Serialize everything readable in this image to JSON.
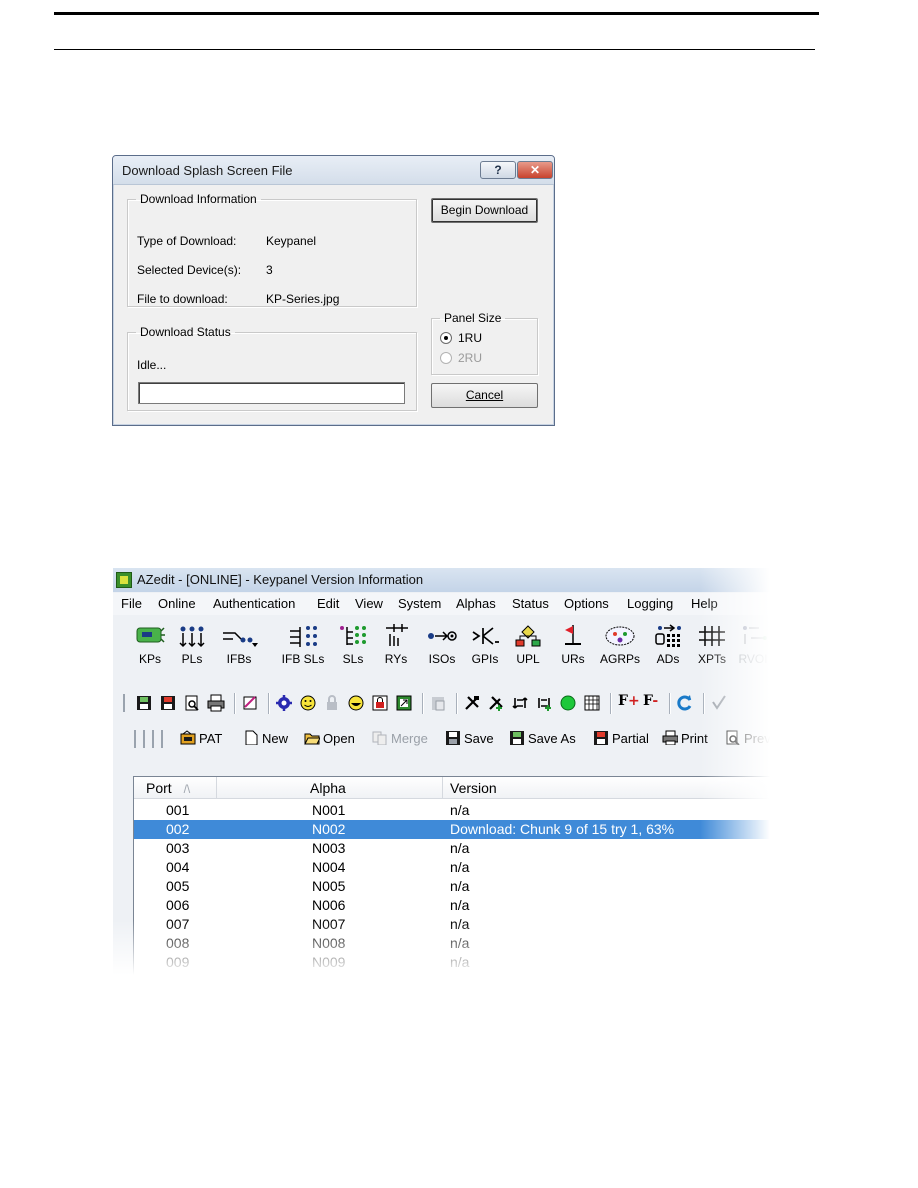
{
  "dialog": {
    "title": "Download Splash Screen File",
    "help_btn": "?",
    "close_btn": "✕",
    "download_info_legend": "Download Information",
    "rows": [
      {
        "label": "Type of Download:",
        "value": "Keypanel"
      },
      {
        "label": "Selected Device(s):",
        "value": "3"
      },
      {
        "label": "File to download:",
        "value": "KP-Series.jpg"
      }
    ],
    "status_legend": "Download Status",
    "status_text": "Idle...",
    "begin_btn": "Begin Download",
    "panel_size_legend": "Panel Size",
    "panel_sizes": [
      "1RU",
      "2RU"
    ],
    "panel_size_selected": "1RU",
    "cancel_btn": "Cancel"
  },
  "azedit": {
    "title": "AZedit - [ONLINE] - Keypanel Version Information",
    "menu": [
      "File",
      "Online",
      "Authentication",
      "Edit",
      "View",
      "System",
      "Alphas",
      "Status",
      "Options",
      "Logging",
      "Help"
    ],
    "big_toolbar": [
      {
        "label": "KPs",
        "icon": "keypanel-icon"
      },
      {
        "label": "PLs",
        "icon": "party-line-icon"
      },
      {
        "label": "IFBs",
        "icon": "ifb-icon"
      },
      {
        "label": "IFB SLs",
        "icon": "ifb-sl-icon"
      },
      {
        "label": "SLs",
        "icon": "special-list-icon"
      },
      {
        "label": "RYs",
        "icon": "relay-icon"
      },
      {
        "label": "ISOs",
        "icon": "iso-icon"
      },
      {
        "label": "GPIs",
        "icon": "gpi-icon"
      },
      {
        "label": "UPL",
        "icon": "upl-icon"
      },
      {
        "label": "URs",
        "icon": "ur-flag-icon"
      },
      {
        "label": "AGRPs",
        "icon": "agrp-icon"
      },
      {
        "label": "ADs",
        "icon": "ad-icon"
      },
      {
        "label": "XPTs",
        "icon": "crosspoint-icon"
      },
      {
        "label": "RVOI",
        "icon": "rvoi-icon"
      }
    ],
    "file_toolbar": [
      {
        "label": "PAT",
        "icon": "pat-icon"
      },
      {
        "label": "New",
        "icon": "new-file-icon"
      },
      {
        "label": "Open",
        "icon": "open-folder-icon"
      },
      {
        "label": "Merge",
        "icon": "merge-icon",
        "disabled": true
      },
      {
        "label": "Save",
        "icon": "save-icon"
      },
      {
        "label": "Save As",
        "icon": "save-as-icon"
      },
      {
        "label": "Partial",
        "icon": "partial-save-icon"
      },
      {
        "label": "Print",
        "icon": "print-icon"
      },
      {
        "label": "Prev",
        "icon": "print-preview-icon"
      }
    ],
    "list": {
      "headers": {
        "port": "Port",
        "alpha": "Alpha",
        "version": "Version"
      },
      "rows": [
        {
          "port": "001",
          "alpha": "N001",
          "version": "n/a"
        },
        {
          "port": "002",
          "alpha": "N002",
          "version": "Download: Chunk 9 of 15 try 1,  63%",
          "selected": true
        },
        {
          "port": "003",
          "alpha": "N003",
          "version": "n/a"
        },
        {
          "port": "004",
          "alpha": "N004",
          "version": "n/a"
        },
        {
          "port": "005",
          "alpha": "N005",
          "version": "n/a"
        },
        {
          "port": "006",
          "alpha": "N006",
          "version": "n/a"
        },
        {
          "port": "007",
          "alpha": "N007",
          "version": "n/a"
        },
        {
          "port": "008",
          "alpha": "N008",
          "version": "n/a"
        },
        {
          "port": "009",
          "alpha": "N009",
          "version": "n/a"
        }
      ]
    }
  }
}
